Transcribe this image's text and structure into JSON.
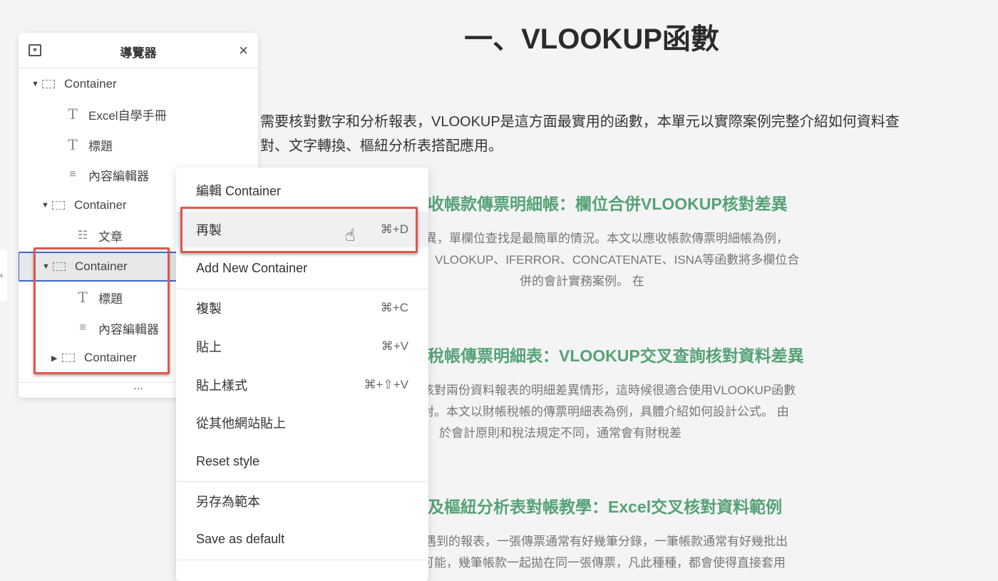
{
  "main": {
    "title": "一、VLOOKUP函數",
    "intro": [
      "需要核對數字和分析報表，VLOOKUP是這方面最實用的函數，本單元以實際案例完整介紹如何資料查",
      "對、文字轉換、樞紐分析表搭配應用。"
    ],
    "sections": [
      {
        "heading": "收帳款傳票明細帳：欄位合併VLOOKUP核對差異",
        "lines": [
          "異，單欄位查找是最簡單的情況。本文以應收帳款傳票明細帳為例，",
          "VLOOKUP、IFERROR、CONCATENATE、ISNA等函數將多欄位合",
          "併的會計實務案例。 在"
        ]
      },
      {
        "heading": "稅帳傳票明細表：VLOOKUP交叉查詢核對資料差異",
        "lines": [
          "核對兩份資料報表的明細差異情形，這時候很適合使用VLOOKUP函數",
          "對。本文以財帳稅帳的傳票明細表為例，具體介紹如何設計公式。 由",
          "於會計原則和稅法規定不同，通常會有財稅差"
        ]
      },
      {
        "heading": "及樞紐分析表對帳教學：Excel交叉核對資料範例",
        "lines": [
          "遇到的報表，一張傳票通常有好幾筆分錄，一筆帳款通常有好幾批出",
          "可能，幾筆帳款一起拋在同一張傳票，凡此種種，都會使得直接套用"
        ]
      }
    ]
  },
  "navigator": {
    "title": "導覽器",
    "close": "×",
    "more": "...",
    "items": [
      {
        "label": "Container",
        "icon": "container-icon"
      },
      {
        "label": "Excel自學手冊",
        "icon": "text-icon"
      },
      {
        "label": "標題",
        "icon": "text-icon"
      },
      {
        "label": "內容編輯器",
        "icon": "text-editor-icon"
      },
      {
        "label": "Container",
        "icon": "container-icon"
      },
      {
        "label": "文章",
        "icon": "posts-icon"
      },
      {
        "label": "Container",
        "icon": "container-icon"
      },
      {
        "label": "標題",
        "icon": "text-icon"
      },
      {
        "label": "內容編輯器",
        "icon": "text-editor-icon"
      },
      {
        "label": "Container",
        "icon": "container-icon"
      }
    ]
  },
  "context_menu": {
    "items": [
      {
        "label": "編輯 Container",
        "shortcut": ""
      },
      {
        "label": "再製",
        "shortcut": "⌘+D"
      },
      {
        "label": "Add New Container",
        "shortcut": ""
      },
      {
        "label": "複製",
        "shortcut": "⌘+C"
      },
      {
        "label": "貼上",
        "shortcut": "⌘+V"
      },
      {
        "label": "貼上樣式",
        "shortcut": "⌘+⇧+V"
      },
      {
        "label": "從其他網站貼上",
        "shortcut": ""
      },
      {
        "label": "Reset style",
        "shortcut": ""
      },
      {
        "label": "另存為範本",
        "shortcut": ""
      },
      {
        "label": "Save as default",
        "shortcut": ""
      }
    ]
  },
  "colors": {
    "heading_green": "#55a276",
    "highlight_red": "#e0574a",
    "selection_blue": "#3a68c8"
  }
}
